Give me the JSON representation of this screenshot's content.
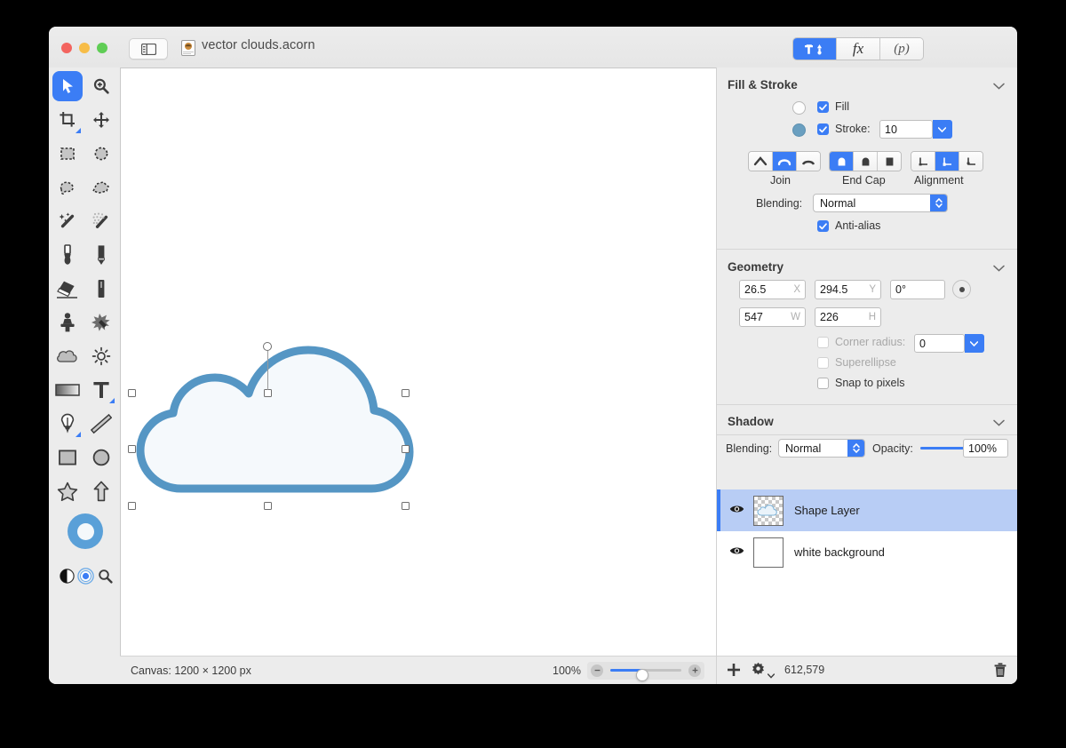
{
  "window": {
    "document_title": "vector clouds.acorn",
    "doc_icon": "acorn-document-icon",
    "sidebar_toggle_icon": "sidebar-toggle-icon",
    "traffic_lights": [
      "close-button",
      "minimize-button",
      "zoom-button"
    ]
  },
  "titlebar_segments": [
    {
      "name": "tools-segment",
      "label": "",
      "icon": "hammer-pen-icon",
      "active": true
    },
    {
      "name": "effects-segment",
      "label": "fx",
      "icon": "fx-icon",
      "active": false
    },
    {
      "name": "palette-segment",
      "label": "(p)",
      "icon": "palette-icon",
      "active": false
    }
  ],
  "tools": [
    {
      "name": "move-tool",
      "icon": "cursor-arrow-icon",
      "selected": true
    },
    {
      "name": "zoom-tool",
      "icon": "magnifier-plus-icon",
      "selected": false
    },
    {
      "name": "crop-tool",
      "icon": "crop-icon",
      "selected": false
    },
    {
      "name": "transform-tool",
      "icon": "move-arrows-icon",
      "selected": false
    },
    {
      "name": "rect-select-tool",
      "icon": "rect-marquee-icon",
      "selected": false
    },
    {
      "name": "ellipse-select-tool",
      "icon": "ellipse-marquee-icon",
      "selected": false
    },
    {
      "name": "lasso-tool",
      "icon": "lasso-icon",
      "selected": false
    },
    {
      "name": "polygon-lasso-tool",
      "icon": "polygon-lasso-icon",
      "selected": false
    },
    {
      "name": "magic-wand-tool",
      "icon": "magic-wand-icon",
      "selected": false
    },
    {
      "name": "instant-alpha-tool",
      "icon": "dotted-wand-icon",
      "selected": false
    },
    {
      "name": "brush-tool",
      "icon": "paintbrush-icon",
      "selected": false
    },
    {
      "name": "pencil-tool",
      "icon": "pencil-icon",
      "selected": false
    },
    {
      "name": "eraser-tool",
      "icon": "eraser-icon",
      "selected": false
    },
    {
      "name": "smudge-tool",
      "icon": "smudge-stick-icon",
      "selected": false
    },
    {
      "name": "clone-stamp-tool",
      "icon": "clone-stamp-icon",
      "selected": false
    },
    {
      "name": "blemish-tool",
      "icon": "blemish-remover-icon",
      "selected": false
    },
    {
      "name": "dodge-tool",
      "icon": "cloud-dodge-icon",
      "selected": false
    },
    {
      "name": "burn-tool",
      "icon": "sun-burn-icon",
      "selected": false
    },
    {
      "name": "gradient-tool",
      "icon": "gradient-icon",
      "selected": false
    },
    {
      "name": "text-tool",
      "icon": "text-t-icon",
      "selected": false
    },
    {
      "name": "bezier-tool",
      "icon": "pen-nib-icon",
      "selected": false
    },
    {
      "name": "line-tool",
      "icon": "line-icon",
      "selected": false
    },
    {
      "name": "rectangle-tool",
      "icon": "rectangle-shape-icon",
      "selected": false
    },
    {
      "name": "ellipse-tool",
      "icon": "ellipse-shape-icon",
      "selected": false
    },
    {
      "name": "star-tool",
      "icon": "star-shape-icon",
      "selected": false
    },
    {
      "name": "arrow-tool",
      "icon": "arrow-shape-icon",
      "selected": false
    }
  ],
  "tool_footer": [
    {
      "name": "invert-colors-button",
      "icon": "half-circle-icon"
    },
    {
      "name": "default-colors-button",
      "icon": "target-dot-icon"
    },
    {
      "name": "loupe-button",
      "icon": "magnifier-icon"
    }
  ],
  "canvas": {
    "size_label": "Canvas: 1200 × 1200 px",
    "zoom_label": "100%",
    "zoom_out_icon": "minus-circle-icon",
    "zoom_in_icon": "plus-circle-icon",
    "zoom_slider_percent": 45
  },
  "statusbar_right": {
    "add_layer_icon": "plus-icon",
    "actions_icon": "gear-icon",
    "actions_caret": "caret-down-icon",
    "memory_label": "612,579",
    "delete_icon": "trash-icon"
  },
  "fill_stroke": {
    "title": "Fill & Stroke",
    "collapse_icon": "chevron-down-icon",
    "fill": {
      "label": "Fill",
      "checked": true,
      "swatch_color": "#fdfdfd"
    },
    "stroke": {
      "label": "Stroke:",
      "checked": true,
      "swatch_color": "#6a9fc0",
      "width_value": "10"
    },
    "join": {
      "label": "Join",
      "options": [
        {
          "name": "join-miter",
          "icon": "miter-join-icon",
          "active": false
        },
        {
          "name": "join-round",
          "icon": "round-join-icon",
          "active": true
        },
        {
          "name": "join-bevel",
          "icon": "bevel-join-icon",
          "active": false
        }
      ]
    },
    "end_cap": {
      "label": "End Cap",
      "options": [
        {
          "name": "cap-round",
          "icon": "round-cap-icon",
          "active": true
        },
        {
          "name": "cap-butt",
          "icon": "butt-cap-icon",
          "active": false
        },
        {
          "name": "cap-square",
          "icon": "square-cap-icon",
          "active": false
        }
      ]
    },
    "alignment": {
      "label": "Alignment",
      "options": [
        {
          "name": "align-inside",
          "icon": "align-inside-icon",
          "active": false
        },
        {
          "name": "align-center",
          "icon": "align-center-icon",
          "active": true
        },
        {
          "name": "align-outside",
          "icon": "align-outside-icon",
          "active": false
        }
      ]
    },
    "blending": {
      "label": "Blending:",
      "value": "Normal"
    },
    "anti_alias": {
      "label": "Anti-alias",
      "checked": true
    }
  },
  "geometry": {
    "title": "Geometry",
    "collapse_icon": "chevron-down-icon",
    "x": {
      "value": "26.5",
      "unit": "X"
    },
    "y": {
      "value": "294.5",
      "unit": "Y"
    },
    "rotation": {
      "value": "0°"
    },
    "rotation_knob_icon": "rotation-knob-icon",
    "w": {
      "value": "547",
      "unit": "W"
    },
    "h": {
      "value": "226",
      "unit": "H"
    },
    "corner_radius": {
      "label": "Corner radius:",
      "checked": false,
      "enabled": false,
      "value": "0"
    },
    "superellipse": {
      "label": "Superellipse",
      "checked": false,
      "enabled": false
    },
    "snap_to_pixels": {
      "label": "Snap to pixels",
      "checked": false,
      "enabled": true
    }
  },
  "shadow": {
    "title": "Shadow",
    "collapse_icon": "chevron-down-icon",
    "blending": {
      "label": "Blending:",
      "value": "Normal"
    },
    "opacity": {
      "label": "Opacity:",
      "value": "100%",
      "percent": 100
    }
  },
  "layers": [
    {
      "name": "Shape Layer",
      "selected": true,
      "visible": true,
      "thumb": "checkerboard-cloud-thumb",
      "eye_icon": "eye-icon"
    },
    {
      "name": "white background",
      "selected": false,
      "visible": true,
      "thumb": "white-thumb",
      "eye_icon": "eye-icon"
    }
  ],
  "shape": {
    "name": "cloud-shape",
    "stroke_color": "#5596c4",
    "fill_color": "#f5f9fc",
    "handles": 8,
    "rotation_handle": true
  },
  "colors": {
    "accent": "#3b7df5",
    "window_bg": "#ececec",
    "stroke_blue": "#5596c4",
    "selection_blue": "#b8cdf5"
  }
}
